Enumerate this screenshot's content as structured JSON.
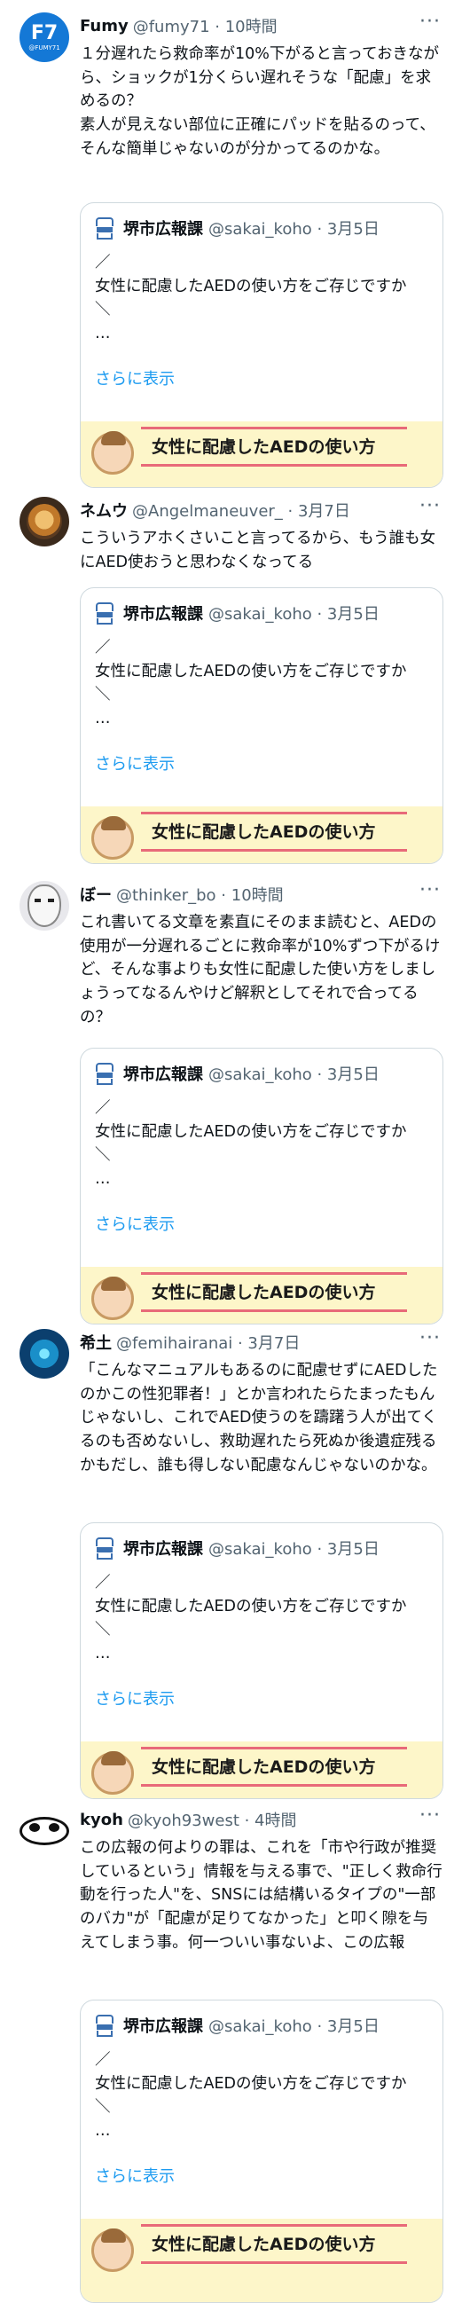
{
  "quoted": {
    "name": "堺市広報課",
    "handle": "@sakai_koho · 3月5日",
    "body": "／\n女性に配慮したAEDの使い方をご存じですか\n＼\n…",
    "more_label": "さらに表示",
    "banner_text": "女性に配慮したAEDの使い方"
  },
  "tweets": [
    {
      "name": "Fumy",
      "handle": "@fumy71 · 10時間",
      "more": "···",
      "avatar_text": "F7",
      "avatar_sub": "@FUMY71",
      "text": "１分遅れたら救命率が10%下がると言っておきながら、ショックが1分くらい遅れそうな「配慮」を求めるの？\n素人が見えない部位に正確にパッドを貼るのって、そんな簡単じゃないのが分かってるのかな。"
    },
    {
      "name": "ネムウ",
      "handle": "@Angelmaneuver_ · 3月7日",
      "more": "···",
      "text": "こういうアホくさいこと言ってるから、もう誰も女にAED使おうと思わなくなってる"
    },
    {
      "name": "ぼー",
      "handle": "@thinker_bo · 10時間",
      "more": "···",
      "text": "これ書いてる文章を素直にそのまま読むと、AEDの使用が一分遅れるごとに救命率が10%ずつ下がるけど、そんな事よりも女性に配慮した使い方をしましょうってなるんやけど解釈としてそれで合ってるの？"
    },
    {
      "name": "希土",
      "handle": "@femihairanai · 3月7日",
      "more": "···",
      "text": "「こんなマニュアルもあるのに配慮せずにAEDしたのかこの性犯罪者！」とか言われたらたまったもんじゃないし、これでAED使うのを躊躇う人が出てくるのも否めないし、救助遅れたら死ぬか後遺症残るかもだし、誰も得しない配慮なんじゃないのかな。"
    },
    {
      "name": "kyoh",
      "handle": "@kyoh93west · 4時間",
      "more": "···",
      "text": "この広報の何よりの罪は、これを「市や行政が推奨しているという」情報を与える事で、\"正しく救命行動を行った人\"を、SNSには結構いるタイプの\"一部のバカ\"が「配慮が足りてなかった」と叩く隙を与えてしまう事。何一ついい事ないよ、この広報"
    }
  ]
}
